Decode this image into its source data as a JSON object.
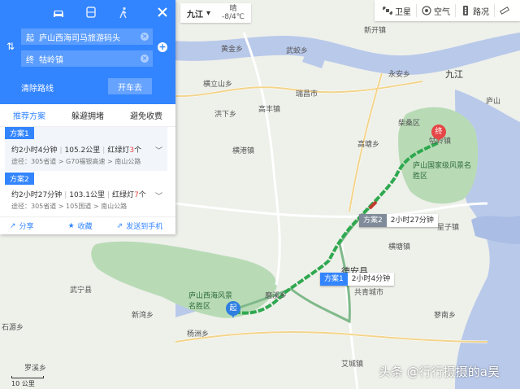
{
  "panel": {
    "travel_modes": [
      {
        "name": "car-icon",
        "active": true
      },
      {
        "name": "bus-icon",
        "active": false
      },
      {
        "name": "walk-icon",
        "active": false
      }
    ],
    "start": {
      "label": "起",
      "value": "庐山西海司马旅游码头"
    },
    "end": {
      "label": "终",
      "value": "牯岭镇"
    },
    "clear_label": "清除路线",
    "go_label": "开车去",
    "tabs": [
      "推荐方案",
      "躲避拥堵",
      "避免收费"
    ],
    "plans": [
      {
        "tag": "方案1",
        "duration": "约2小时4分钟",
        "distance": "105.2公里",
        "lights_label": "红绿灯",
        "lights_count": "3",
        "lights_unit": "个",
        "via": "途径：305省道 > G70福银高速 > 南山公路"
      },
      {
        "tag": "方案2",
        "duration": "约2小时27分钟",
        "distance": "103.1公里",
        "lights_label": "红绿灯",
        "lights_count": "7",
        "lights_unit": "个",
        "via": "途径：305省道 > 105国道 > 南山公路"
      }
    ],
    "actions": {
      "share": "分享",
      "favorite": "收藏",
      "send": "发送到手机"
    }
  },
  "top": {
    "city": "九江",
    "weather_top": "晴",
    "weather_bottom": "-8/4℃",
    "tools": [
      "卫星",
      "空气",
      "路况"
    ]
  },
  "map": {
    "labels": [
      "九江",
      "新开镇",
      "永安乡",
      "瑞昌市",
      "武蛟乡",
      "黄金乡",
      "横立山乡",
      "庐山",
      "柴桑区",
      "高丰镇",
      "洪下乡",
      "横港镇",
      "牯岭镇",
      "庐山国家级风景名胜区",
      "星子镇",
      "德安县",
      "共青城市",
      "横塘镇",
      "庐山西海风景名胜区",
      "磨溪乡",
      "杨洲乡",
      "石源乡",
      "罗溪乡",
      "艾城镇",
      "武宁县",
      "新湾乡",
      "蓼南乡",
      "高塘乡"
    ],
    "route_badges": [
      {
        "label": "方案2",
        "time": "2小时27分钟"
      },
      {
        "label": "方案1",
        "time": "2小时4分钟"
      }
    ],
    "start_pin": "起",
    "end_pin": "终",
    "scale": "10 公里",
    "colors": {
      "accent": "#3385ff",
      "route": "#2fa84f",
      "water": "#b9c9ea",
      "park": "#b8dbb6"
    }
  },
  "watermark": "头条 @行行摄摄的a昊"
}
